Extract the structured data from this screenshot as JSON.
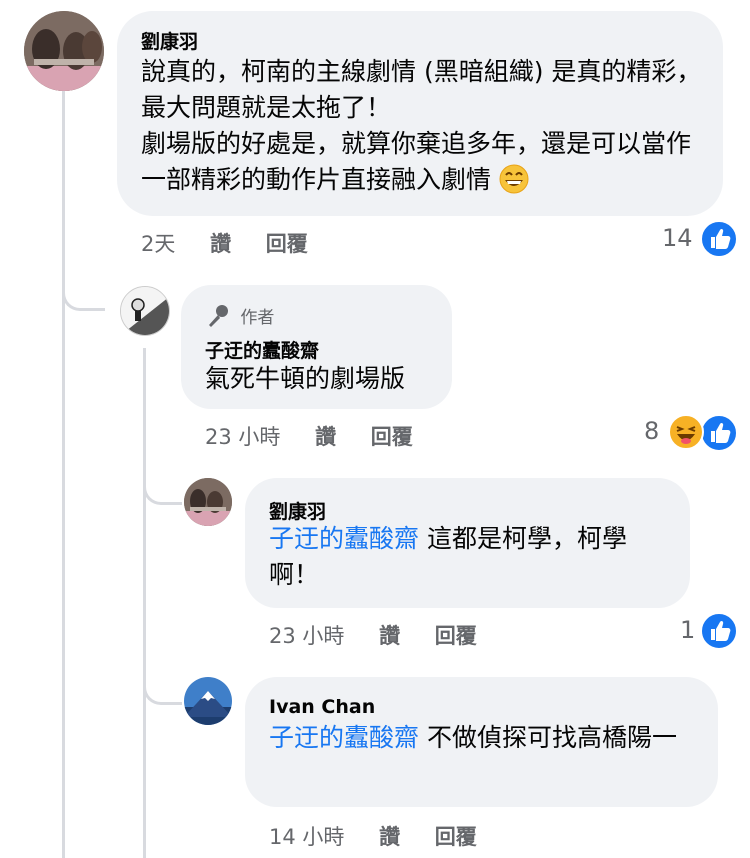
{
  "comments": [
    {
      "author": "劉康羽",
      "text": "說真的，柯南的主線劇情 (黑暗組織) 是真的精彩，最大問題就是太拖了！\n劇場版的好處是，就算你棄追多年，還是可以當作一部精彩的動作片直接融入劇情",
      "time": "2天",
      "like_action": "讚",
      "reply_action": "回覆",
      "reaction_count": "14"
    },
    {
      "badge": "作者",
      "author": "子迂的蠹酸齋",
      "text": "氣死牛頓的劇場版",
      "time": "23 小時",
      "like_action": "讚",
      "reply_action": "回覆",
      "reaction_count": "8"
    },
    {
      "author": "劉康羽",
      "mention": "子迂的蠹酸齋",
      "text": "這都是柯學，柯學啊！",
      "time": "23 小時",
      "like_action": "讚",
      "reply_action": "回覆",
      "reaction_count": "1"
    },
    {
      "author": "Ivan Chan",
      "mention": "子迂的蠹酸齋",
      "text": "不做偵探可找高橋陽一",
      "time": "14 小時",
      "like_action": "讚",
      "reply_action": "回覆"
    }
  ],
  "icons": {
    "like": "thumbs-up-icon",
    "haha": "laughing-emoji-icon",
    "grin": "grinning-emoji-icon",
    "author_badge": "microphone-icon"
  },
  "colors": {
    "bubble": "#f0f2f5",
    "mention": "#1877f2",
    "meta": "#65676b",
    "like": "#1877f2"
  }
}
